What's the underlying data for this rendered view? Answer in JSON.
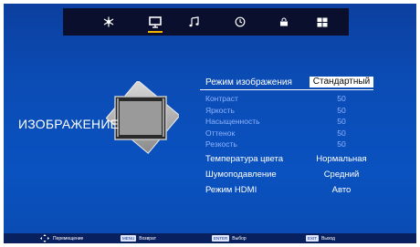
{
  "tabs": [
    {
      "icon": "snowflake-icon"
    },
    {
      "icon": "monitor-icon",
      "active": true
    },
    {
      "icon": "music-note-icon"
    },
    {
      "icon": "clock-icon"
    },
    {
      "icon": "lock-icon"
    },
    {
      "icon": "grid-icon"
    }
  ],
  "section_title": "ИЗОБРАЖЕНИЕ",
  "menu": {
    "selected": {
      "label": "Режим изображения",
      "value": "Стандартный"
    },
    "dim_rows": [
      {
        "label": "Контраст",
        "value": "50"
      },
      {
        "label": "Яркость",
        "value": "50"
      },
      {
        "label": "Насыщенность",
        "value": "50"
      },
      {
        "label": "Оттенок",
        "value": "50"
      },
      {
        "label": "Резкость",
        "value": "50"
      }
    ],
    "rows": [
      {
        "label": "Температура цвета",
        "value": "Нормальная"
      },
      {
        "label": "Шумоподавление",
        "value": "Средний"
      },
      {
        "label": "Режим HDMI",
        "value": "Авто"
      }
    ]
  },
  "hints": {
    "move": "Перемещение",
    "menu_key": "MENU",
    "menu_label": "Возврат",
    "enter_key": "ENTER",
    "enter_label": "Выбор",
    "exit_key": "EXIT",
    "exit_label": "Выход"
  },
  "colors": {
    "accent": "#f4b400",
    "background": "#0b4bb4",
    "topbar": "#0a0f2e"
  }
}
